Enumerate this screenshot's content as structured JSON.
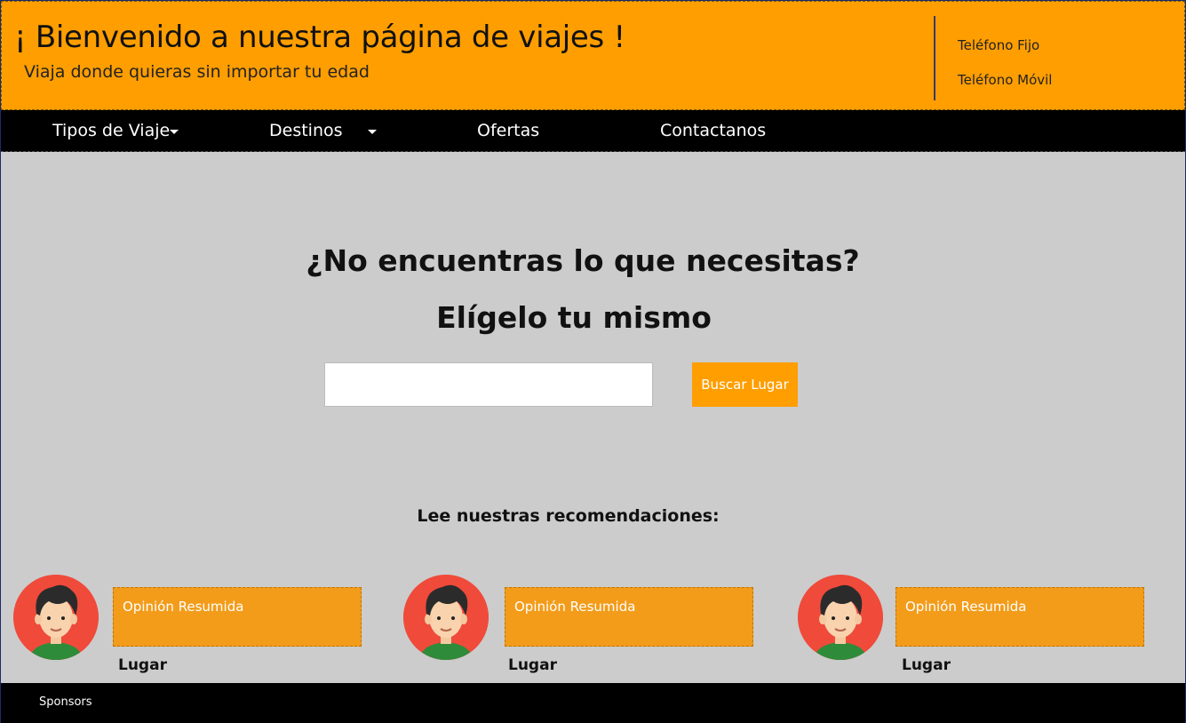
{
  "header": {
    "title": "¡ Bienvenido a nuestra página de viajes !",
    "subtitle": "Viaja donde quieras sin importar tu edad",
    "phone_fixed": "Teléfono Fijo",
    "phone_mobile": "Teléfono Móvil",
    "background_color": "#ff9e00"
  },
  "nav": {
    "items": [
      {
        "label": "Tipos de Viaje",
        "has_dropdown": true
      },
      {
        "label": "Destinos",
        "has_dropdown": true
      },
      {
        "label": "Ofertas",
        "has_dropdown": false
      },
      {
        "label": "Contactanos",
        "has_dropdown": false
      }
    ]
  },
  "main": {
    "question": "¿No encuentras lo que necesitas?",
    "choose": "Elígelo tu mismo",
    "search": {
      "value": "",
      "placeholder": "",
      "button_label": "Buscar Lugar"
    },
    "recommendations_heading": "Lee nuestras recomendaciones:",
    "recommendations": [
      {
        "opinion": "Opinión Resumida",
        "place": "Lugar",
        "avatar_icon": "user-avatar-icon"
      },
      {
        "opinion": "Opinión Resumida",
        "place": "Lugar",
        "avatar_icon": "user-avatar-icon"
      },
      {
        "opinion": "Opinión Resumida",
        "place": "Lugar",
        "avatar_icon": "user-avatar-icon"
      }
    ]
  },
  "footer": {
    "sponsors": "Sponsors"
  },
  "colors": {
    "accent": "#ff9e00",
    "opinion_box": "#f39c1a",
    "nav_background": "#000000",
    "page_background": "#cccccc"
  }
}
